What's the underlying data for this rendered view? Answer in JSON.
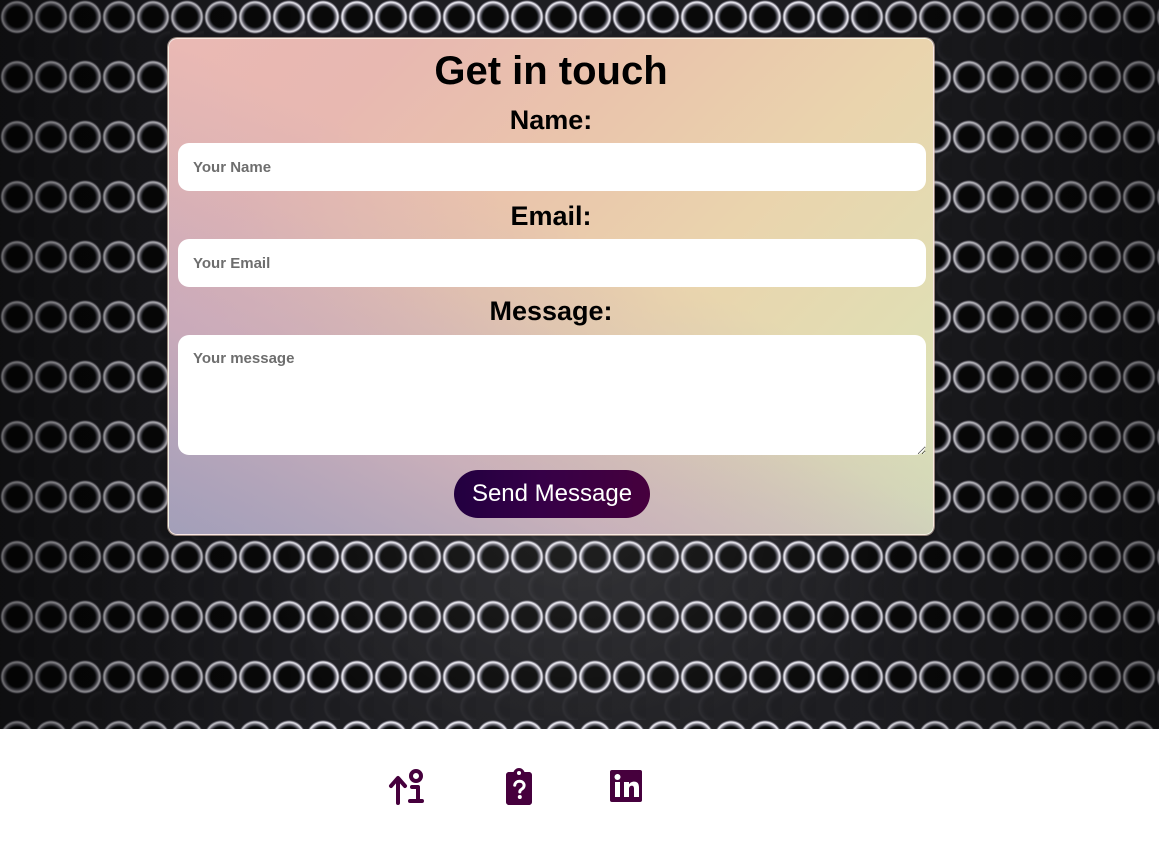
{
  "contact_form": {
    "title": "Get in touch",
    "name_label": "Name:",
    "name_placeholder": "Your Name",
    "email_label": "Email:",
    "email_placeholder": "Your Email",
    "message_label": "Message:",
    "message_placeholder": "Your message",
    "send_button_label": "Send Message"
  },
  "footer": {
    "links": [
      {
        "icon": "up-arrow-info-icon"
      },
      {
        "icon": "clipboard-question-icon"
      },
      {
        "icon": "linkedin-icon"
      }
    ]
  },
  "colors": {
    "accent": "#46003d",
    "button_start": "#220040",
    "button_end": "#46003d",
    "card_pink": "#e8b8b1",
    "card_green": "#d9e6b9"
  }
}
